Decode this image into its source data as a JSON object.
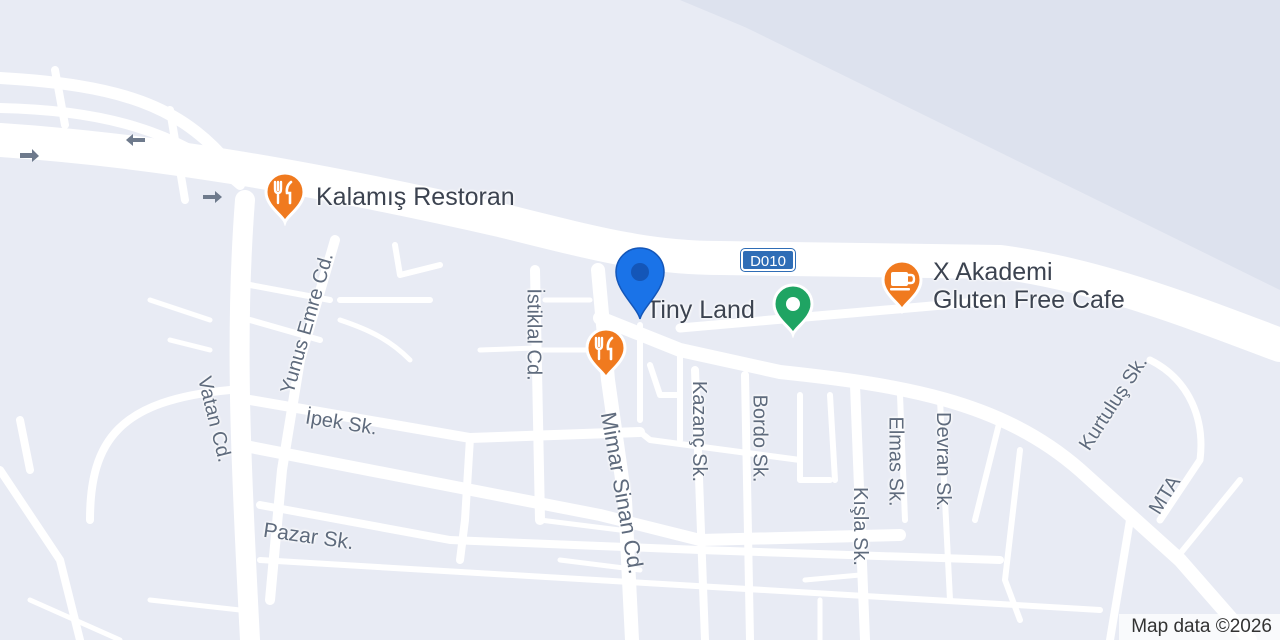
{
  "map": {
    "copyright": "Map data ©2026",
    "route_shield": "D010",
    "colors": {
      "background": "#e8ebf4",
      "road": "#ffffff",
      "water_band": "#dde2ee",
      "street_label": "#5f6b7d",
      "restaurant_pin": "#f07a1f",
      "cafe_pin": "#f07a1f",
      "park_pin": "#1fa463",
      "location_pin": "#1a73e8",
      "route_shield": "#2f6db6"
    },
    "pois": [
      {
        "name": "Kalamış Restoran",
        "icon": "fork-knife-icon",
        "type": "restaurant"
      },
      {
        "name": "",
        "icon": "fork-knife-icon",
        "type": "restaurant"
      },
      {
        "name": "X Akademi\nGluten Free Cafe",
        "line1": "X Akademi",
        "line2": "Gluten Free Cafe",
        "icon": "coffee-cup-icon",
        "type": "cafe"
      },
      {
        "name": "Tiny Land",
        "icon": "park-dot-icon",
        "type": "park"
      }
    ],
    "streets": [
      "Yunus Emre Cd.",
      "İstiklal Cd.",
      "Vatan Cd.",
      "İpek Sk.",
      "Mimar Sinan Cd.",
      "Kazanç Sk.",
      "Bordo Sk.",
      "Elmas Sk.",
      "Devran Sk.",
      "Kurtuluş Sk.",
      "Kışla Sk.",
      "MTA",
      "Pazar Sk."
    ]
  }
}
